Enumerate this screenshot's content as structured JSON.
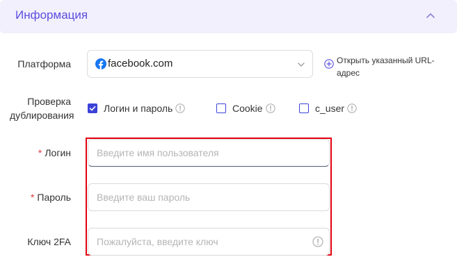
{
  "section": {
    "title": "Информация"
  },
  "platform": {
    "label": "Платформа",
    "value": "facebook.com",
    "open_url_text": "Открыть указанный URL-адрес"
  },
  "duplicate_check": {
    "label_line1": "Проверка",
    "label_line2": "дублирования",
    "options": [
      {
        "label": "Логин и пароль",
        "checked": true
      },
      {
        "label": "Cookie",
        "checked": false
      },
      {
        "label": "c_user",
        "checked": false
      }
    ]
  },
  "login": {
    "required_mark": "*",
    "label": "Логин",
    "placeholder": "Введите имя пользователя"
  },
  "password": {
    "required_mark": "*",
    "label": "Пароль",
    "placeholder": "Введите ваш пароль"
  },
  "twofa": {
    "label": "Ключ 2FA",
    "placeholder": "Пожалуйста, введите ключ"
  },
  "colors": {
    "accent": "#5b4de0",
    "checkbox": "#3c42d6",
    "required": "#e0393e",
    "highlight": "#e3000f",
    "facebook": "#1877f2"
  },
  "icons": {
    "collapse": "chevron-up-icon",
    "platform": "facebook-icon",
    "dropdown": "chevron-down-icon",
    "open_url": "plus-circle-icon",
    "info": "info-circle-icon"
  }
}
